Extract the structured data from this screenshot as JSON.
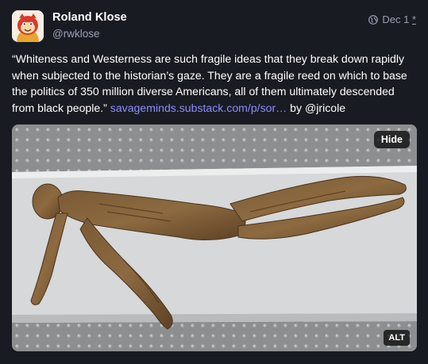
{
  "account": {
    "display_name": "Roland Klose",
    "handle": "@rwklose",
    "avatar_icon": "cartoon-avatar-icon"
  },
  "meta": {
    "visibility_icon": "globe-icon",
    "date": "Dec 1",
    "edited_mark": "*"
  },
  "post": {
    "text": "“Whiteness and Westerness are such fragile ideas that they break down rapidly when subjected to the historian’s gaze. They are a fragile reed on which to base the politics of 350 million diverse Americans, all of them ultimately descended from black people.”",
    "link": "savageminds.substack.com/p/sor…",
    "attribution": "by @jricole"
  },
  "media": {
    "hide_label": "Hide",
    "alt_label": "ALT"
  },
  "colors": {
    "background": "#191b22",
    "link": "#8c8dff",
    "muted": "#9aa0b5"
  }
}
